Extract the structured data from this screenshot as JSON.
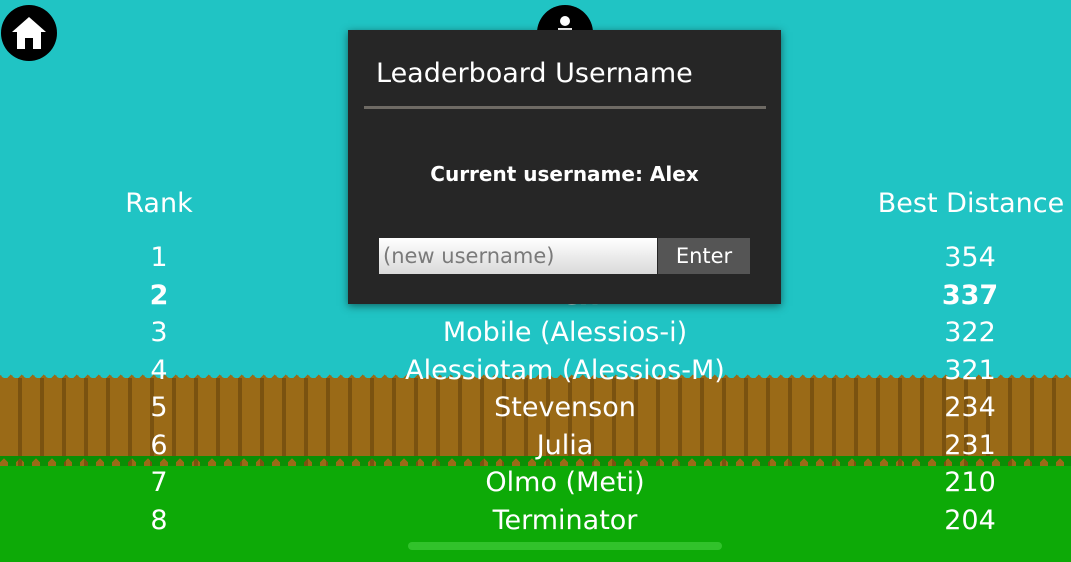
{
  "toolbar": {
    "home_icon": "home-icon",
    "user_icon": "user-icon"
  },
  "leaderboard": {
    "rank_header": "Rank",
    "distance_header": "Best Distance",
    "rows": [
      {
        "rank": "1",
        "name": "",
        "distance": "354"
      },
      {
        "rank": "2",
        "name": "Alex",
        "distance": "337"
      },
      {
        "rank": "3",
        "name": "Mobile (Alessios-i)",
        "distance": "322"
      },
      {
        "rank": "4",
        "name": "Alessiotam (Alessios-M)",
        "distance": "321"
      },
      {
        "rank": "5",
        "name": "Stevenson",
        "distance": "234"
      },
      {
        "rank": "6",
        "name": "Julia",
        "distance": "231"
      },
      {
        "rank": "7",
        "name": "Olmo (Meti)",
        "distance": "210"
      },
      {
        "rank": "8",
        "name": "Terminator",
        "distance": "204"
      }
    ]
  },
  "dialog": {
    "title": "Leaderboard Username",
    "message": "Current username: Alex",
    "input_placeholder": "(new username)",
    "input_value": "",
    "enter_label": "Enter"
  },
  "colors": {
    "sky": "#20c4c4",
    "fence": "#9a6a17",
    "grass": "#0daa07",
    "dialog": "#262626"
  }
}
